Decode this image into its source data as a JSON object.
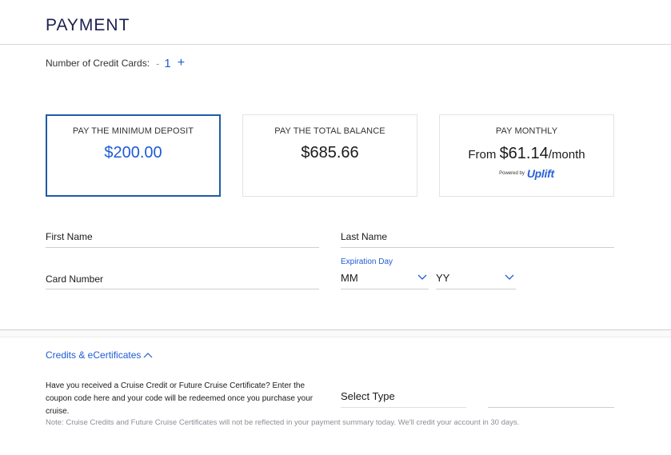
{
  "header": {
    "title": "PAYMENT"
  },
  "credit_cards": {
    "label": "Number of Credit Cards:",
    "minus": "-",
    "count": "1",
    "plus": "+"
  },
  "payment_options": [
    {
      "title": "PAY THE MINIMUM DEPOSIT",
      "amount": "$200.00",
      "selected": true
    },
    {
      "title": "PAY THE TOTAL BALANCE",
      "amount": "$685.66",
      "selected": false
    },
    {
      "title": "PAY MONTHLY",
      "prefix": "From ",
      "amount": "$61.14",
      "suffix": "/month",
      "powered_by": "Powered by",
      "brand": "Uplift",
      "selected": false
    }
  ],
  "form": {
    "first_name": "First Name",
    "last_name": "Last Name",
    "card_number": "Card Number",
    "expiration_label": "Expiration Day",
    "month_value": "MM",
    "year_value": "YY"
  },
  "credits": {
    "toggle_label": "Credits & eCertificates",
    "description": "Have you received a Cruise Credit or Future Cruise Certificate? Enter the coupon code here and your code will be redeemed once you purchase your cruise.",
    "select_type": "Select Type",
    "code_value": "",
    "note": "Note: Cruise Credits and Future Cruise Certificates will not be reflected in your payment summary today. We'll credit your account in 30 days."
  },
  "colors": {
    "accent": "#1e5bd6",
    "selected_border": "#1f5ba8",
    "title": "#1b2050",
    "note": "#8a8f96"
  },
  "icons": {
    "expand": "chevron-down-icon",
    "collapse": "chevron-up-icon"
  }
}
